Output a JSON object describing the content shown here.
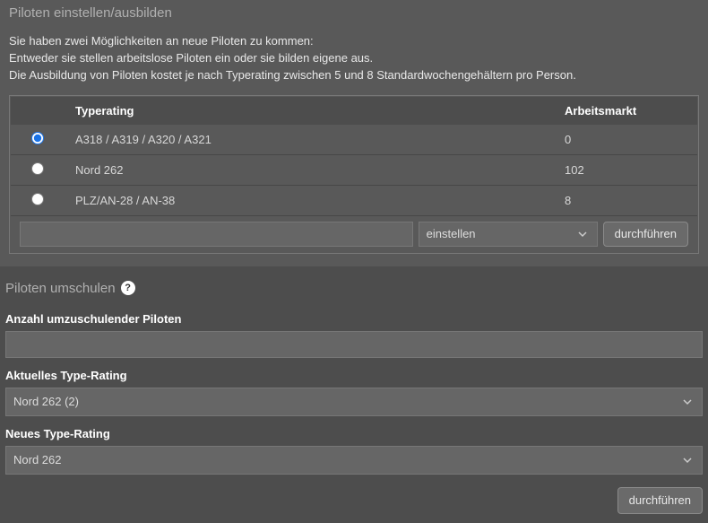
{
  "section1": {
    "title": "Piloten einstellen/ausbilden",
    "intro_lines": [
      "Sie haben zwei Möglichkeiten an neue Piloten zu kommen:",
      "Entweder sie stellen arbeitslose Piloten ein oder sie bilden eigene aus.",
      "Die Ausbildung von Piloten kostet je nach Typerating zwischen 5 und 8 Standardwochengehältern pro Person."
    ],
    "table": {
      "header_typerating": "Typerating",
      "header_market": "Arbeitsmarkt",
      "rows": [
        {
          "rating": "A318 / A319 / A320 / A321",
          "market": "0",
          "selected": true
        },
        {
          "rating": "Nord 262",
          "market": "102",
          "selected": false
        },
        {
          "rating": "PLZ/AN-28 / AN-38",
          "market": "8",
          "selected": false
        }
      ]
    },
    "action_select_value": "einstellen",
    "action_button": "durchführen"
  },
  "section2": {
    "title": "Piloten umschulen",
    "help_symbol": "?",
    "count_label": "Anzahl umzuschulender Piloten",
    "count_value": "",
    "current_rating_label": "Aktuelles Type-Rating",
    "current_rating_value": "Nord 262 (2)",
    "new_rating_label": "Neues Type-Rating",
    "new_rating_value": "Nord 262",
    "submit_button": "durchführen"
  }
}
